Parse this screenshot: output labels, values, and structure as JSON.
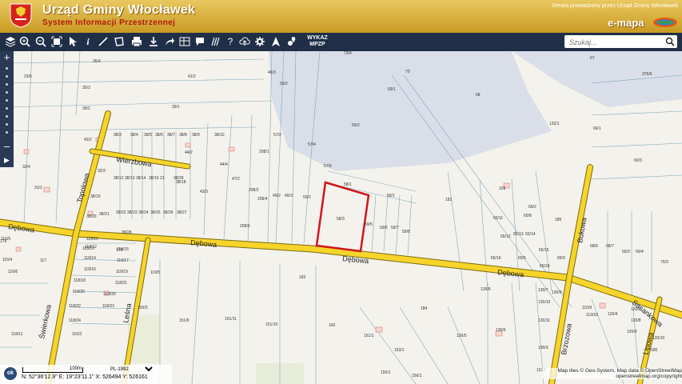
{
  "header": {
    "title": "Urząd Gminy Włocławek",
    "subtitle": "System Informacji Przestrzennej",
    "service_text": "Serwis prowadzony przez Urząd Gminy Włocławek",
    "emapa_text": "e-mapa",
    "colors": {
      "bar": "#d4a83a",
      "title": "#ffffff",
      "subtitle": "#b0180f"
    }
  },
  "toolbar": {
    "wyk_line1": "WYKAZ",
    "wyk_line2": "MPZP",
    "search_placeholder": "Szukaj..."
  },
  "map": {
    "streets": [
      "Dębowa",
      "Dębowa",
      "Dębowa",
      "Wierzbowa",
      "Topolowa",
      "Świerkowa",
      "Leśna",
      "Bukowa",
      "Brzozowa",
      "Lipowa",
      "Sasankowa"
    ],
    "parcels": [
      "35/4",
      "23/6",
      "35/3",
      "41/2",
      "46/3",
      "53/2",
      "73/4",
      "70",
      "69/1",
      "67",
      "376/6",
      "68",
      "132/1",
      "66/1",
      "60/3",
      "55/2",
      "35/2",
      "39/1",
      "38/3",
      "38/4",
      "38/5",
      "38/6",
      "38/7",
      "38/8",
      "38/9",
      "38/10",
      "44/2",
      "43/2",
      "32/4",
      "31/2",
      "32/3",
      "38/12",
      "38/13",
      "38/14",
      "38/16",
      "21",
      "38/29",
      "38/19",
      "38/18",
      "38/20",
      "38/21",
      "38/22",
      "38/23",
      "38/24",
      "38/25",
      "38/26",
      "38/27",
      "38/28",
      "44/4",
      "43/3",
      "47/2",
      "208/1",
      "208/2",
      "208/4",
      "208/3",
      "49/2",
      "49/3",
      "50/2",
      "57/2",
      "57/4",
      "57/5",
      "58/1",
      "58/3",
      "59/1",
      "59/5",
      "59/6",
      "59/7",
      "59/8",
      "181",
      "185",
      "109",
      "69/2",
      "65/11",
      "65/8",
      "65/12",
      "65/13",
      "65/14",
      "65/15",
      "65/16",
      "65/5",
      "65/18",
      "65/9",
      "68/6",
      "68/7",
      "69/3",
      "69/4",
      "70/3",
      "116/5",
      "116/4",
      "116/6",
      "117",
      "178",
      "118/10",
      "118/12",
      "118/14",
      "118/15",
      "118/16",
      "118/17",
      "118/18",
      "118/19",
      "118/20",
      "118/21",
      "118/22",
      "118/23",
      "118/34",
      "118/35",
      "116/3",
      "118/11",
      "118/13",
      "179",
      "119/5",
      "120/3",
      "151/6",
      "151/11",
      "151/10",
      "183",
      "184",
      "160",
      "161/1",
      "153/1",
      "155/1",
      "156/1",
      "126/5",
      "126/6",
      "130/6",
      "130/7",
      "130/9",
      "130/10",
      "130/11",
      "130/3",
      "110/1",
      "110/9",
      "119/10",
      "120/4",
      "120/7",
      "120/8",
      "120/9",
      "120/10",
      "180"
    ],
    "colors": {
      "road": "#f6d42a",
      "road_border": "#7a6a10",
      "water": "#d9dee8",
      "parcel_line": "#6a9ab0",
      "highlight": "#d0151c"
    }
  },
  "status": {
    "ok_label": "ok",
    "scale_label": "100m",
    "crs_value": "PL-1992",
    "coords": "N: 52°36'12.9\"  E: 19°23'11.1\"  X: 526494   Y: 526161"
  },
  "attribution": {
    "line1": "Map tiles © Geo-System, Map data © OpenStreetMap",
    "line2": "openstreetmap.org/copyright"
  }
}
